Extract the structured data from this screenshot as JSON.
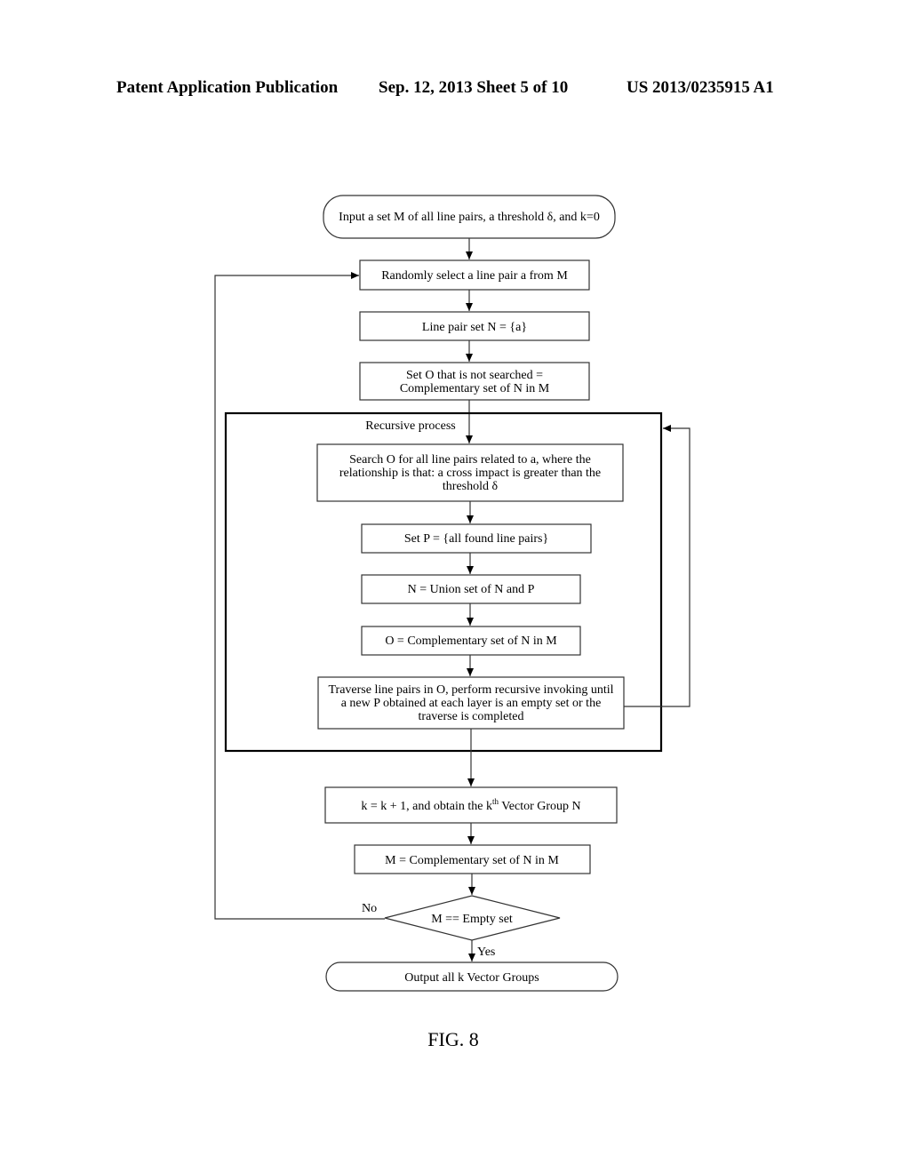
{
  "header": {
    "publication": "Patent Application Publication",
    "date_sheet": "Sep. 12, 2013   Sheet 5 of 10",
    "number": "US 2013/0235915 A1"
  },
  "flowchart": {
    "start": "Input a set M of all line pairs, a threshold δ, and k=0",
    "select": "Randomly select a line pair a from M",
    "init_n": "Line pair set N = {a}",
    "set_o": [
      "Set O that is not searched =",
      "Complementary set of N in M"
    ],
    "recursive_label": "Recursive process",
    "search": [
      "Search O for all line pairs related to a, where the",
      "relationship is that: a cross impact is greater than the",
      "threshold δ"
    ],
    "set_p": "Set P = {all found line pairs}",
    "union": "N = Union set of N and P",
    "update_o": "O = Complementary set of N in M",
    "traverse": [
      "Traverse line pairs in O, perform recursive invoking until",
      "a new P obtained at each layer is an empty set or the",
      "traverse is completed"
    ],
    "increment_k": {
      "pre": "k = k + 1, and obtain the k",
      "sup": "th",
      "post": " Vector Group N"
    },
    "update_m": "M = Complementary set of N in M",
    "decision": "M == Empty set",
    "no_label": "No",
    "yes_label": "Yes",
    "output": "Output all k Vector Groups"
  },
  "figure_label": "FIG. 8"
}
